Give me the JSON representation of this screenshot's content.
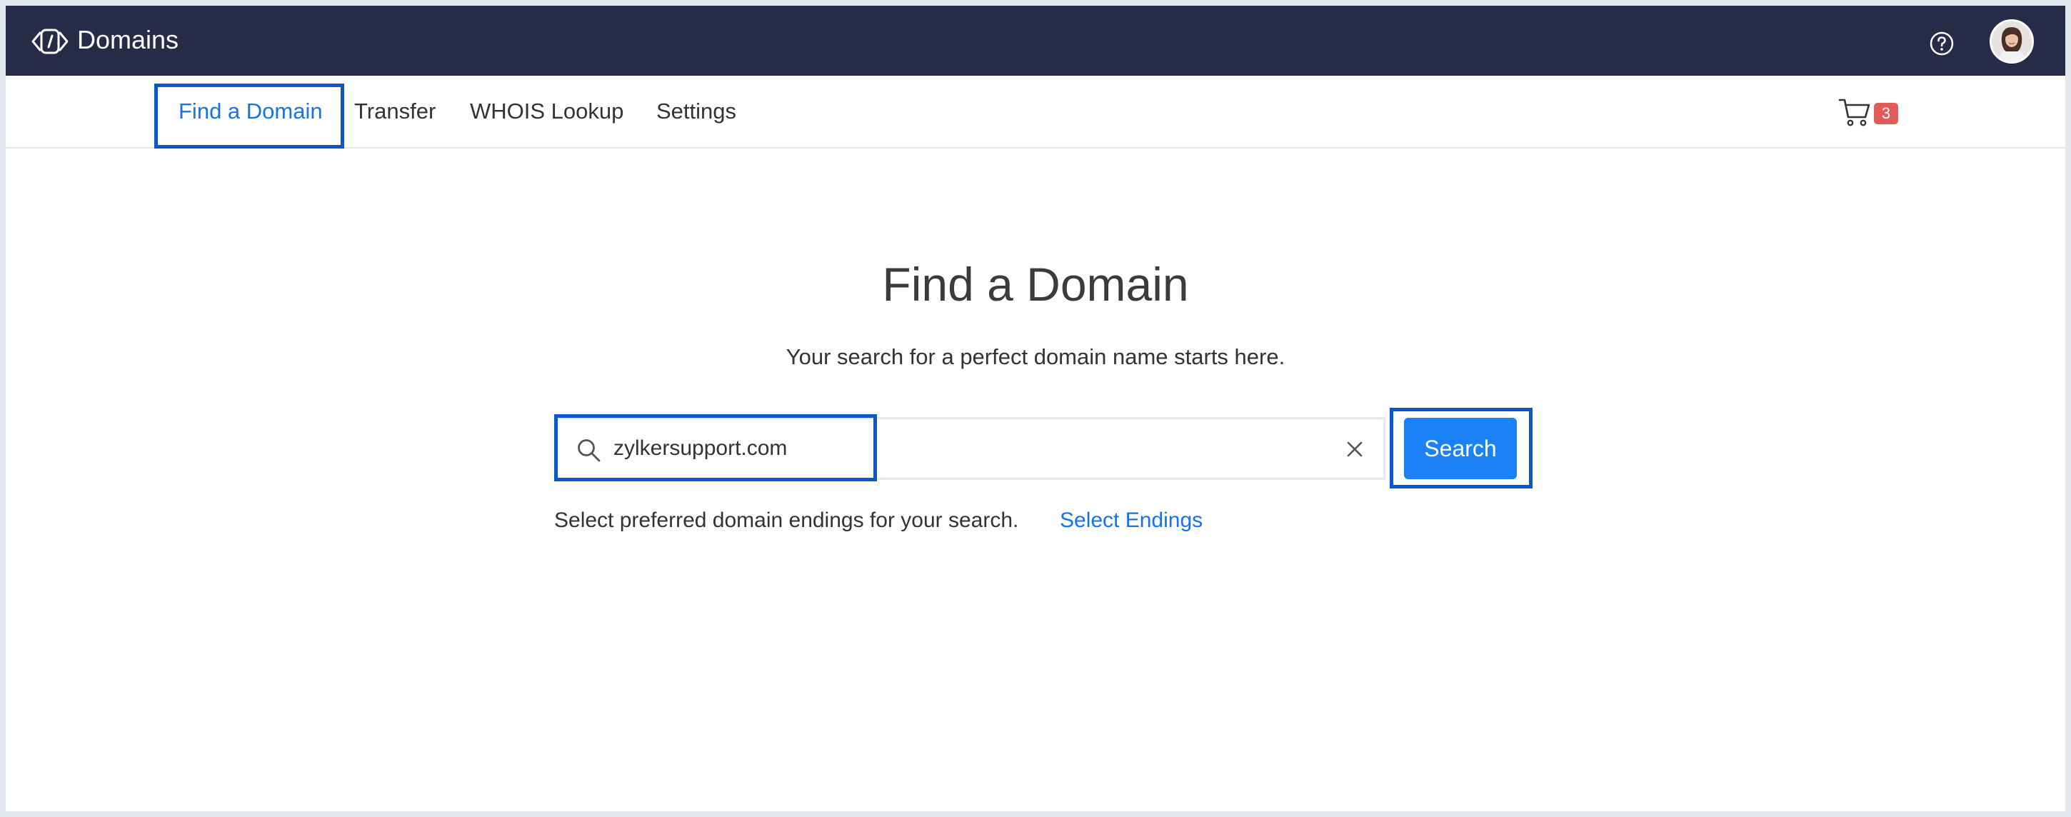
{
  "app": {
    "title": "Domains",
    "brand_icon": "domains-code-icon",
    "help_icon": "help-circle-icon",
    "avatar_icon": "user-avatar"
  },
  "nav": {
    "items": [
      {
        "label": "Find a Domain",
        "active": true
      },
      {
        "label": "Transfer",
        "active": false
      },
      {
        "label": "WHOIS Lookup",
        "active": false
      },
      {
        "label": "Settings",
        "active": false
      }
    ],
    "cart_icon": "cart-icon",
    "cart_count": "3"
  },
  "main": {
    "title": "Find a Domain",
    "subtitle": "Your search for a perfect domain name starts here.",
    "search": {
      "value": "zylkersupport.com",
      "placeholder": "",
      "search_icon": "search-icon",
      "clear_icon": "close-icon",
      "button_label": "Search"
    },
    "endings_text": "Select preferred domain endings for your search.",
    "endings_link": "Select Endings"
  },
  "colors": {
    "header_bg": "#262b47",
    "accent": "#1773e6",
    "button_bg": "#1a82f6",
    "badge_bg": "#e25b5b",
    "highlight": "#0b57d0"
  }
}
